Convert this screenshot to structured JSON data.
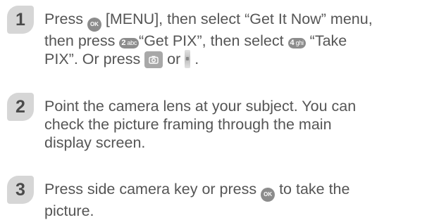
{
  "steps": [
    {
      "number": "1",
      "line1_a": "Press ",
      "ok_icon": "OK",
      "line1_b": " [MENU], then select “Get It Now” menu,",
      "line2_a": "then press ",
      "key2": {
        "num": "2",
        "letters": "abc"
      },
      "line2_b": "“Get PIX”, then select ",
      "key4": {
        "num": "4",
        "letters": "ghi"
      },
      "line2_c": " “Take",
      "line3_a": "PIX”. Or press ",
      "line3_b": " or ",
      "line3_c": " .",
      "camera_key_icon": "camera-key-icon",
      "side_key_icon": "side-camera-key-icon"
    },
    {
      "number": "2",
      "lines": [
        "Point the camera lens at your subject. You can",
        "check the picture framing through the main",
        "display screen."
      ]
    },
    {
      "number": "3",
      "line1_a": "Press side camera key or press ",
      "ok_icon": "OK",
      "line1_b": " to take the",
      "line2": "picture."
    }
  ]
}
